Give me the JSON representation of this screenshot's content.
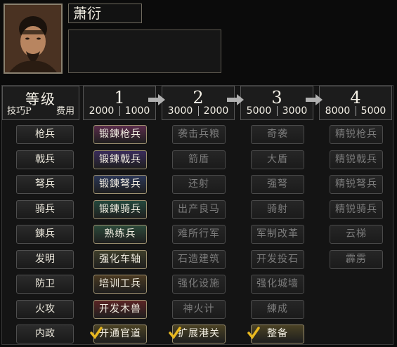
{
  "general": {
    "name": "萧衍"
  },
  "header": {
    "level_label": "等级",
    "tech_label": "技巧P",
    "cost_label": "费用",
    "levels": [
      {
        "num": "1",
        "tech": "2000",
        "cost": "1000"
      },
      {
        "num": "2",
        "tech": "3000",
        "cost": "2000"
      },
      {
        "num": "3",
        "tech": "5000",
        "cost": "3000"
      },
      {
        "num": "4",
        "tech": "8000",
        "cost": "5000"
      }
    ]
  },
  "rows": [
    {
      "label": "枪兵",
      "techs": [
        "锻鍊枪兵",
        "袭击兵粮",
        "奇袭",
        "精锐枪兵"
      ],
      "color": "#5a2c4a"
    },
    {
      "label": "戟兵",
      "techs": [
        "锻鍊戟兵",
        "箭盾",
        "大盾",
        "精锐戟兵"
      ],
      "color": "#3a2c5a"
    },
    {
      "label": "弩兵",
      "techs": [
        "锻鍊弩兵",
        "还射",
        "强弩",
        "精锐弩兵"
      ],
      "color": "#2a3656"
    },
    {
      "label": "骑兵",
      "techs": [
        "锻鍊骑兵",
        "出产良马",
        "骑射",
        "精锐骑兵"
      ],
      "color": "#24483c"
    },
    {
      "label": "鍊兵",
      "techs": [
        "熟练兵",
        "难所行军",
        "军制改革",
        "云梯"
      ],
      "color": "#2c4a3a"
    },
    {
      "label": "发明",
      "techs": [
        "强化车轴",
        "石造建筑",
        "开发投石",
        "霹雳"
      ],
      "color": "#3e3e2a"
    },
    {
      "label": "防卫",
      "techs": [
        "培训工兵",
        "强化设施",
        "强化城墙",
        ""
      ],
      "color": "#4a3a22"
    },
    {
      "label": "火攻",
      "techs": [
        "开发木兽",
        "神火计",
        "練成",
        ""
      ],
      "color": "#5a2424"
    },
    {
      "label": "内政",
      "techs": [
        "开通官道",
        "扩展港关",
        "整备",
        ""
      ],
      "color": "#4a4224"
    }
  ],
  "unlocked_columns": {
    "0-3": [
      0
    ],
    "8": [
      0,
      1,
      2
    ]
  }
}
